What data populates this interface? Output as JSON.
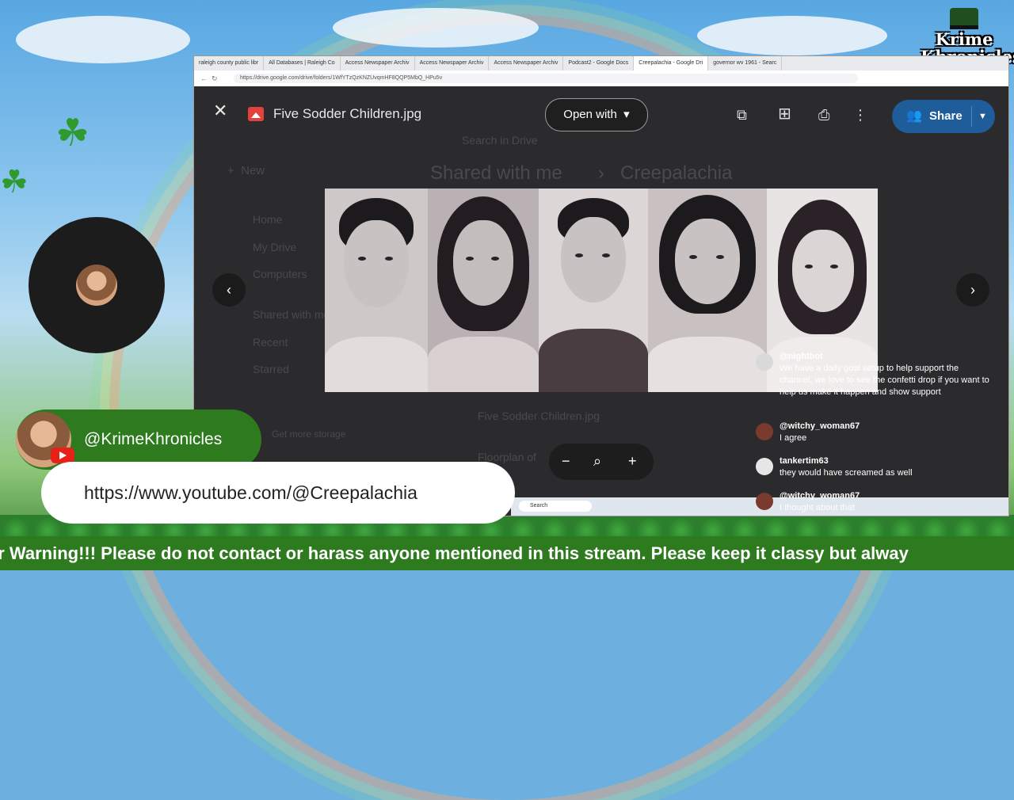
{
  "overlay": {
    "logo_text": "Krime Khronicles",
    "handle": "@KrimeKhronicles",
    "channel_url": "https://www.youtube.com/@Creepalachia",
    "marquee": "er Warning!!! Please do not contact or harass anyone mentioned in this stream. Please keep it classy but alway"
  },
  "browser": {
    "tabs": [
      {
        "label": "raleigh county public libr",
        "active": false
      },
      {
        "label": "All Databases | Raleigh Co",
        "active": false
      },
      {
        "label": "Access Newspaper Archiv",
        "active": false
      },
      {
        "label": "Access Newspaper Archiv",
        "active": false
      },
      {
        "label": "Access Newspaper Archiv",
        "active": false
      },
      {
        "label": "Podcast2 - Google Docs",
        "active": false
      },
      {
        "label": "Creepalachia - Google Dri",
        "active": true
      },
      {
        "label": "governor wv 1961 - Searc",
        "active": false
      }
    ],
    "url": "https://drive.google.com/drive/folders/1WfYTzQzKNZUvqmHF8QQP5MbQ_HPu5v"
  },
  "drive_background": {
    "search_placeholder": "Search in Drive",
    "new_label": "New",
    "nav": [
      "Home",
      "My Drive",
      "Computers",
      "Shared with me",
      "Recent",
      "Starred"
    ],
    "breadcrumb": [
      "Shared with me",
      "Creepalachia"
    ],
    "files": [
      "Five Sodder Children.jpg",
      "Floorplan of"
    ],
    "storage_label": "Get more storage"
  },
  "viewer": {
    "file_name": "Five Sodder Children.jpg",
    "open_with_label": "Open with",
    "share_label": "Share"
  },
  "taskbar": {
    "search_placeholder": "Search"
  },
  "chat": [
    {
      "user": "@nightbot",
      "text": "We have a daily goal setup to help support the channel, we love to see the confetti drop if you want to help us make it happen and show support",
      "avatar_color": "#d9d9d9"
    },
    {
      "user": "@witchy_woman67",
      "text": "I agree",
      "avatar_color": "#7a3b2e"
    },
    {
      "user": "tankertim63",
      "text": "they would have screamed as well",
      "avatar_color": "#e6e6e6"
    },
    {
      "user": "@witchy_woman67",
      "text": "I thought about that",
      "avatar_color": "#7a3b2e"
    }
  ],
  "colors": {
    "brand_green": "#2d7a1f",
    "share_blue": "#1e5c9a",
    "youtube_red": "#e62117"
  }
}
